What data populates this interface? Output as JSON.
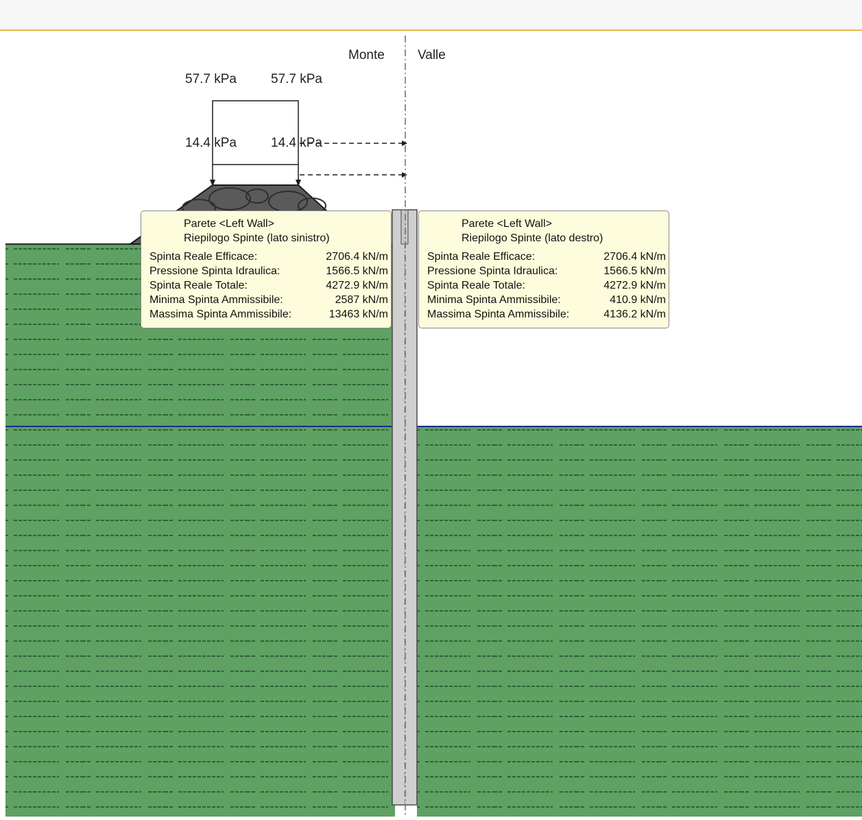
{
  "zones": {
    "left_label": "Monte",
    "right_label": "Valle"
  },
  "surcharge": {
    "top_left": "57.7 kPa",
    "top_right": "57.7 kPa",
    "bottom_left": "14.4 kPa",
    "bottom_right": "14.4 kPa"
  },
  "summary_left": {
    "title": "Parete <Left Wall>",
    "subtitle": "Riepilogo Spinte (lato sinistro)",
    "rows": [
      {
        "label": "Spinta Reale Efficace:",
        "value": "2706.4 kN/m"
      },
      {
        "label": "Pressione Spinta Idraulica:",
        "value": "1566.5 kN/m"
      },
      {
        "label": "Spinta Reale Totale:",
        "value": "4272.9 kN/m"
      },
      {
        "label": "Minima Spinta Ammissibile:",
        "value": "2587 kN/m"
      },
      {
        "label": "Massima Spinta Ammissibile:",
        "value": "13463 kN/m"
      }
    ]
  },
  "summary_right": {
    "title": "Parete <Left Wall>",
    "subtitle": "Riepilogo Spinte (lato destro)",
    "rows": [
      {
        "label": "Spinta Reale Efficace:",
        "value": "2706.4 kN/m"
      },
      {
        "label": "Pressione Spinta Idraulica:",
        "value": "1566.5 kN/m"
      },
      {
        "label": "Spinta Reale Totale:",
        "value": "4272.9 kN/m"
      },
      {
        "label": "Minima Spinta Ammissibile:",
        "value": "410.9 kN/m"
      },
      {
        "label": "Massima Spinta Ammissibile:",
        "value": "4136.2 kN/m"
      }
    ]
  },
  "colors": {
    "soil": "#5fa063",
    "soil_hatch": "#2f6136",
    "water_line": "#1b2a8c",
    "wall": "#cfcfcf",
    "tooltip_bg": "#fdfcdc",
    "accent": "#f5b54a"
  }
}
